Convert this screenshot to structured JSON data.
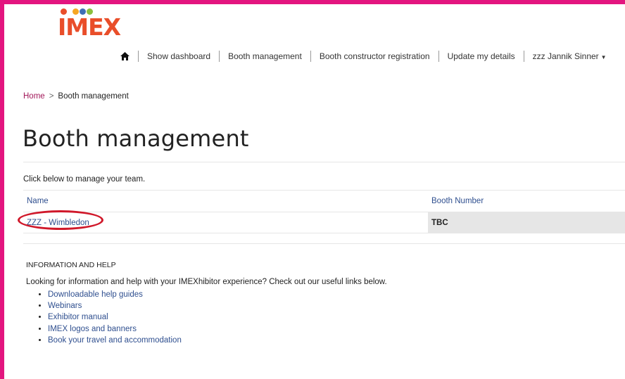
{
  "brand": {
    "logo_text": "IMEX",
    "dot_colors": [
      "#e94e2a",
      "#f6a623",
      "#3f6fb6",
      "#8bbf3d"
    ],
    "accent_color": "#e3157f"
  },
  "nav": {
    "home_icon": "home-icon",
    "items": [
      "Show dashboard",
      "Booth management",
      "Booth constructor registration",
      "Update my details"
    ],
    "user_menu": "zzz Jannik Sinner"
  },
  "breadcrumb": {
    "home": "Home",
    "separator": ">",
    "current": "Booth management"
  },
  "page": {
    "title": "Booth management",
    "intro": "Click below to manage your team."
  },
  "table": {
    "headers": [
      "Name",
      "Booth Number"
    ],
    "rows": [
      {
        "name": "ZZZ - Wimbledon",
        "booth": "TBC"
      }
    ]
  },
  "info": {
    "heading": "INFORMATION AND HELP",
    "text": "Looking for information and help with your IMEXhibitor experience? Check out our useful links below.",
    "links": [
      "Downloadable help guides",
      "Webinars",
      "Exhibitor manual",
      "IMEX logos and banners",
      "Book your travel and accommodation"
    ]
  }
}
